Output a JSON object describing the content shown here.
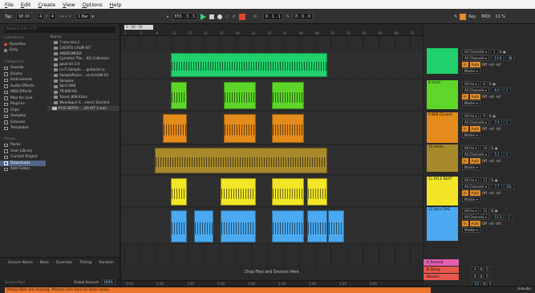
{
  "menu": [
    "File",
    "Edit",
    "Create",
    "View",
    "Options",
    "Help"
  ],
  "transport": {
    "tap": "Tap",
    "tempo": "98.00",
    "ts_num": "4",
    "ts_den": "4",
    "metro": "•• • •",
    "quant": "1 Bar",
    "position": "855 . 3 . 3",
    "loop_start": "9 . 1 . 1",
    "loop_len": "8 . 0 . 0",
    "key": "Key",
    "midi": "MIDI",
    "cpu": "11 %"
  },
  "browser": {
    "search_placeholder": "Search (Ctrl + F)",
    "col_header": "Name",
    "sections": {
      "collections": "Collections",
      "categories": "Categories",
      "places": "Places"
    },
    "collections": [
      {
        "label": "Favorites",
        "color": "#e24f3b"
      },
      {
        "label": "Gray",
        "color": "#8d8d8d"
      }
    ],
    "categories": [
      "Sounds",
      "Drums",
      "Instruments",
      "Audio Effects",
      "MIDI Effects",
      "Max for Live",
      "Plug-Ins",
      "Clips",
      "Samples",
      "Grooves",
      "Templates"
    ],
    "places": [
      "Packs",
      "User Library",
      "Current Project",
      "Downloads",
      "Add Folder..."
    ],
    "files": [
      "7-mix.mix.2",
      "CHEXTO CAUM KIT",
      "ANDROMEDA",
      "Cymatics The ...ID) Collection",
      "good kit 2.0",
      "Lo-Fi Sample ... guitarist.ru",
      "SamplePacks....ve.Hi-HAN-SS",
      "Samples",
      "Spiro 808",
      "TR-808 Kit",
      "Tuned_808 Kicks",
      "Wondagurl S ...mers) Drumkit",
      "KYLE BEATS - ...ER KIT 1.wav"
    ]
  },
  "groove": {
    "headers": [
      "Groove Name",
      "Base",
      "Quantize",
      "Timing",
      "Random"
    ],
    "pool": "Groove Pool",
    "global": "Global Amount",
    "amount": "100%"
  },
  "arrangement": {
    "loop_label": "1 - 16 - 16",
    "bar_ticks": [
      "1",
      "5",
      "9",
      "13",
      "17",
      "21",
      "25",
      "29",
      "33",
      "37",
      "41",
      "45",
      "49",
      "53",
      "57",
      "61",
      "65",
      "69",
      "73"
    ],
    "time_ticks": [
      "0:00",
      "0:30",
      "1:00",
      "1:30",
      "2:00",
      "2:30",
      "3:00",
      "3:30",
      "4:00"
    ],
    "drop_text": "Drop Files and Devices Here"
  },
  "tracks": [
    {
      "name": "",
      "color": "#1fd06b",
      "routing": "All Channels",
      "slot": "Master",
      "num": "1",
      "vol": "-13.8",
      "pan": "48"
    },
    {
      "name": "8 drum",
      "color": "#5ed629",
      "routing": "All Ins",
      "slot": "Master",
      "num": "8",
      "vol": "-6.0",
      "pan": "C"
    },
    {
      "name": "9 808 (Tuned)",
      "color": "#e48b1b",
      "routing": "All Ins",
      "slot": "Master",
      "num": "9",
      "vol": "-7.4",
      "pan": "C"
    },
    {
      "name": "10 sticks",
      "color": "#a88a2b",
      "routing": "All Ins",
      "slot": "Master",
      "num": "10",
      "vol": "-5.1",
      "pan": "C"
    },
    {
      "name": "11 KYLE BEAT",
      "color": "#f2e626",
      "routing": "All Ins",
      "slot": "Master",
      "num": "11",
      "vol": "-7.7",
      "pan": "15L"
    },
    {
      "name": "12 Bass DAS",
      "color": "#4aa9f0",
      "routing": "All Ins",
      "slot": "Master",
      "num": "12",
      "vol": "-13.3",
      "pan": "C"
    }
  ],
  "returns": [
    {
      "name": "A Reverb",
      "color": "#e35fb0",
      "num": "A",
      "vol": "0"
    },
    {
      "name": "B Delay",
      "color": "#e8574c",
      "num": "B",
      "vol": "0"
    },
    {
      "name": "Master",
      "color": "#e8574c",
      "num": "1/2",
      "vol": "0"
    }
  ],
  "status": {
    "warning": "Media files are missing. Please click here to learn more.",
    "right": "3-Audio"
  }
}
